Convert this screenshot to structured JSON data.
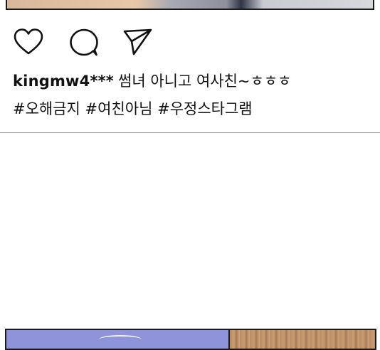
{
  "post": {
    "username": "kingmw4***",
    "message": "썸녀 아니고 여사친~ㅎㅎㅎ",
    "hashtags": "#오해금지 #여친아님 #우정스타그램"
  },
  "actions": {
    "like_icon": "heart-icon",
    "comment_icon": "comment-bubble-icon",
    "share_icon": "paper-plane-icon"
  }
}
